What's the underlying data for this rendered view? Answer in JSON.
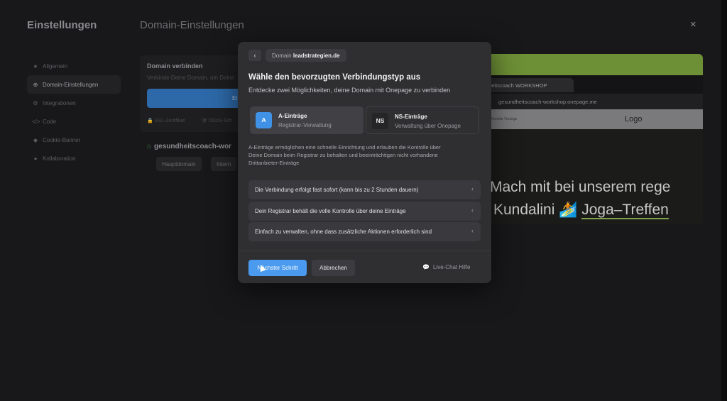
{
  "settings": {
    "title": "Einstellungen",
    "section_title": "Domain-Einstellungen",
    "close_label": "×",
    "sidebar": [
      {
        "label": "Allgemein",
        "icon": "★"
      },
      {
        "label": "Domain-Einstellungen",
        "icon": "⊕"
      },
      {
        "label": "Integrationen",
        "icon": "⚙"
      },
      {
        "label": "Code",
        "icon": "</>"
      },
      {
        "label": "Cookie-Banner",
        "icon": "◆"
      },
      {
        "label": "Kollaboration",
        "icon": "●"
      }
    ],
    "card": {
      "title": "Domain verbinden",
      "text": "Verbinde Deine Domain, um Deine",
      "button": "Ei",
      "feature_1": "SSL-Zertifikat",
      "feature_2": "DDoS-Sch"
    },
    "domain": {
      "name": "gesundheitscoach-wor",
      "chip_1": "Hauptdomain",
      "chip_2": "Intern"
    }
  },
  "preview": {
    "tab_title": "heitscoach WORKSHOP",
    "url": "gesundheitscoach-workshop.onepage.me",
    "nav_links": "Vorteile    Vorzüge",
    "logo": "Logo",
    "heading_line1": "Mach mit bei unserem rege",
    "heading_line2_a": "Kundalini 🏄 ",
    "heading_line2_b": "Joga–Treffen"
  },
  "modal": {
    "back_icon": "‹",
    "breadcrumb_prefix": "Domain",
    "breadcrumb_domain": "leadstrategien.de",
    "heading": "Wähle den bevorzugten Verbindungstyp aus",
    "subheading": "Entdecke zwei Möglichkeiten, deine Domain mit Onepage zu verbinden",
    "options": [
      {
        "badge": "A",
        "title": "A-Einträge",
        "subtitle": "Registrar-Verwaltung"
      },
      {
        "badge": "NS",
        "title": "NS-Einträge",
        "subtitle": "Verwaltung über Onepage"
      }
    ],
    "description": [
      "A-Einträge ermöglichen eine schnelle Einrichtung und erlauben die Kontrolle über",
      "Deine Domain beim Registrar zu behalten und beeinträchtigen nicht vorhandene",
      "Drittanbieter-Einträge"
    ],
    "accordion": [
      "Die Verbindung erfolgt fast sofort (kann bis zu 2 Stunden dauern)",
      "Dein Registrar behält die volle Kontrolle über deine Einträge",
      "Einfach zu verwalten, ohne dass zusätzliche Aktionen erforderlich sind"
    ],
    "chevron": "‹",
    "next_button": "Nächster Schritt",
    "cancel_button": "Abbrechen",
    "chat_icon": "💬",
    "chat_label": "Live-Chat Hilfe"
  },
  "colors": {
    "accent": "#4a9af0",
    "green": "#6d8f36"
  }
}
